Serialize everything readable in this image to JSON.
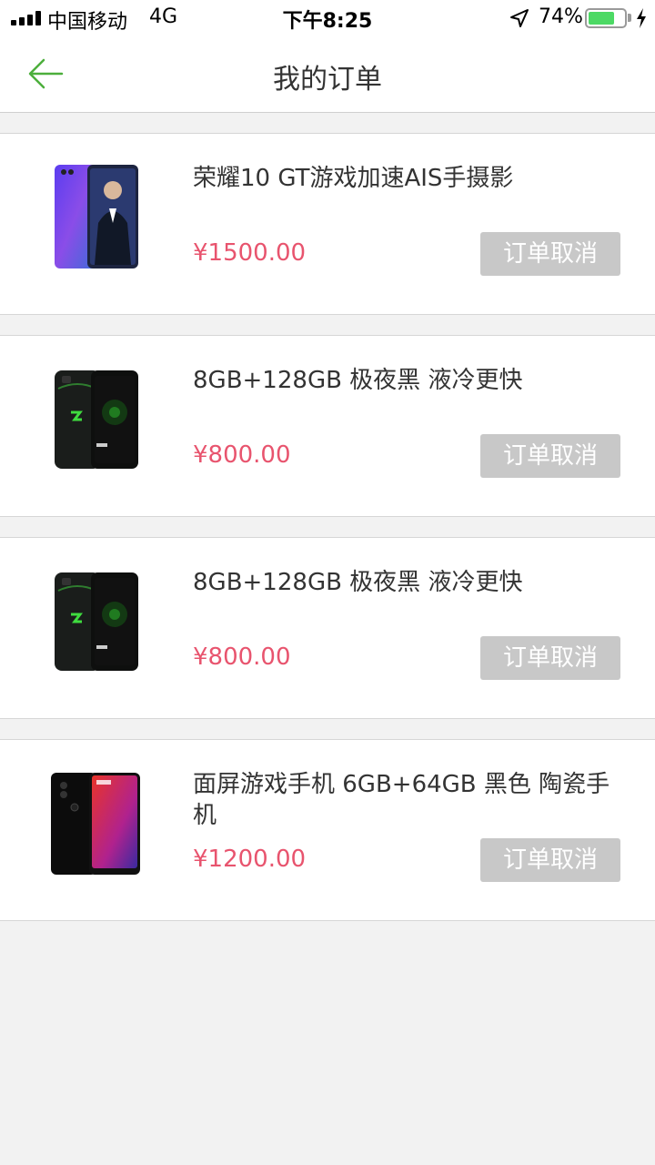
{
  "status_bar": {
    "carrier": "中国移动",
    "network": "4G",
    "time": "下午8:25",
    "battery_percent": "74%",
    "battery_level": 0.74,
    "battery_color": "#4cd964"
  },
  "nav": {
    "title": "我的订单",
    "back_icon": "arrow-left-icon",
    "accent_color": "#4caf3c"
  },
  "orders": [
    {
      "name": "荣耀10 GT游戏加速AIS手摄影",
      "price": "¥1500.00",
      "action": "订单取消",
      "image": "honor-10-phone-image"
    },
    {
      "name": "8GB+128GB 极夜黑 液冷更快",
      "price": "¥800.00",
      "action": "订单取消",
      "image": "black-shark-phone-image"
    },
    {
      "name": "8GB+128GB 极夜黑 液冷更快",
      "price": "¥800.00",
      "action": "订单取消",
      "image": "black-shark-phone-image"
    },
    {
      "name": "面屏游戏手机 6GB+64GB 黑色 陶瓷手机",
      "price": "¥1200.00",
      "action": "订单取消",
      "image": "mi-mix-phone-image"
    }
  ],
  "colors": {
    "price": "#e8546e",
    "button_bg": "#c8c8c8",
    "page_bg": "#f2f2f2"
  }
}
